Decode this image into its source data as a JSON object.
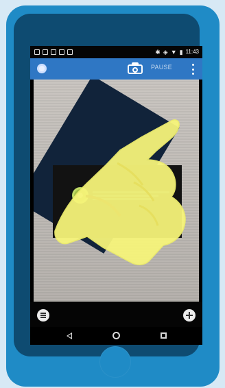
{
  "device": {
    "status_bar": {
      "time": "11:43"
    },
    "app_bar": {
      "label": "PAUSE"
    },
    "icons": {
      "left_app_icon": "compass-icon",
      "camera_icon": "camera-icon",
      "menu_icon": "menu-dots-icon",
      "list_icon": "list-icon",
      "add_icon": "add-icon",
      "back_icon": "back-icon",
      "home_icon": "home-icon",
      "recent_icon": "recent-apps-icon"
    },
    "colors": {
      "phone_blue": "#1f8bc6",
      "phone_frame": "#0e4b71",
      "app_bar": "#2f77c4",
      "hand_overlay": "#f7f57a"
    }
  }
}
